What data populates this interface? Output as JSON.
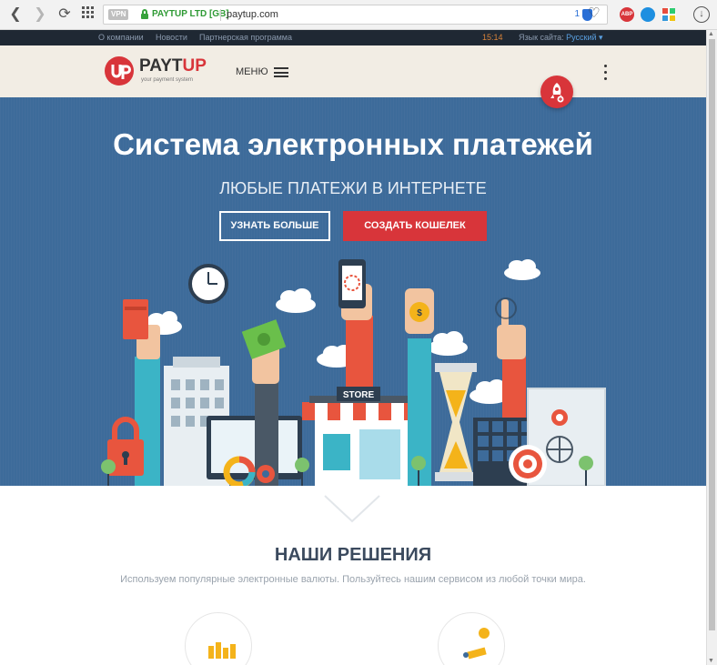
{
  "browser": {
    "vpn_badge": "VPN",
    "cert_owner": "PAYTUP LTD [GB]",
    "url": "paytup.com",
    "extension_count": "1",
    "adblock_label": "ABP"
  },
  "topbar": {
    "links": [
      "О компании",
      "Новости",
      "Партнерская программа"
    ],
    "time": "15:14",
    "lang_label": "Язык сайта:",
    "lang_value": "Русский"
  },
  "header": {
    "logo_pay": "PAYT",
    "logo_up": "UP",
    "logo_tagline": "your payment system",
    "menu_label": "МЕНЮ"
  },
  "hero": {
    "title": "Система электронных платежей",
    "subtitle": "ЛЮБЫЕ ПЛАТЕЖИ В ИНТЕРНЕТЕ",
    "btn_learn": "УЗНАТЬ БОЛЬШЕ",
    "btn_create": "СОЗДАТЬ КОШЕЛЕК",
    "store_sign": "STORE"
  },
  "solutions": {
    "title": "НАШИ РЕШЕНИЯ",
    "description": "Используем популярные электронные валюты. Пользуйтесь нашим сервисом из любой точки мира."
  },
  "colors": {
    "brand_red": "#d8353a",
    "hero_blue": "#3d6b9a",
    "topbar_dark": "#1f2833",
    "header_beige": "#f2ede4"
  }
}
